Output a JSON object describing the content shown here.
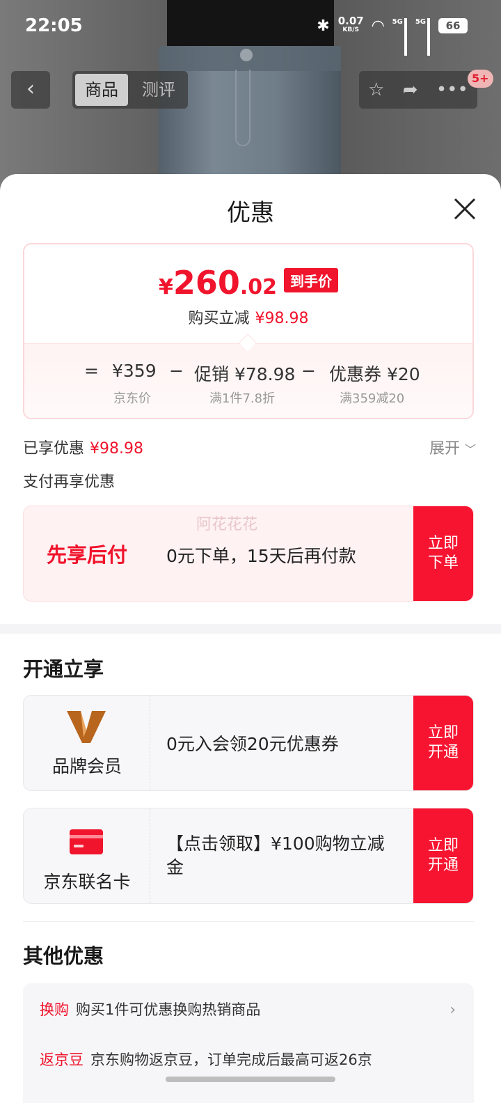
{
  "status_bar": {
    "time": "22:05",
    "net_speed_value": "0.07",
    "net_speed_unit": "KB/S",
    "signal1": "5G",
    "signal2": "5G",
    "battery": "66"
  },
  "nav": {
    "tabs": [
      {
        "label": "商品",
        "active": true
      },
      {
        "label": "测评",
        "active": false
      }
    ],
    "badge": "5+"
  },
  "sheet": {
    "title": "优惠"
  },
  "price_card": {
    "currency": "¥",
    "price_int": "260",
    "price_dec": ".02",
    "tag": "到手价",
    "reduce_label": "购买立减",
    "reduce_value": "¥98.98",
    "formula": {
      "eq": "=",
      "base_value": "¥359",
      "base_label": "京东价",
      "minus1": "−",
      "promo_value": "促销 ¥78.98",
      "promo_label": "满1件7.8折",
      "minus2": "−",
      "coupon_value": "优惠券 ¥20",
      "coupon_label": "满359减20"
    }
  },
  "enjoyed": {
    "label": "已享优惠",
    "value": "¥98.98",
    "expand": "展开"
  },
  "pay_more": {
    "label": "支付再享优惠"
  },
  "bnpl": {
    "name": "先享后付",
    "desc": "0元下单，15天后再付款",
    "cta": "立即\n下单",
    "watermark": "阿花花花"
  },
  "open_section": {
    "title": "开通立享",
    "items": [
      {
        "name": "品牌会员",
        "desc": "0元入会领20元优惠券",
        "cta": "立即\n开通",
        "icon": "brand-v-icon"
      },
      {
        "name": "京东联名卡",
        "desc_line1": "【点击领取】¥100购物立减",
        "desc_line2": "金",
        "cta": "立即\n开通",
        "icon": "credit-card-icon"
      }
    ]
  },
  "other_section": {
    "title": "其他优惠",
    "rows": [
      {
        "tag": "换购",
        "text": "购买1件可优惠换购热销商品"
      },
      {
        "tag": "返京豆",
        "text": "京东购物返京豆，订单完成后最高可返26京"
      }
    ]
  },
  "colors": {
    "accent": "#f0142c",
    "cta": "#f71431",
    "brand_gold": "#b8651e"
  }
}
